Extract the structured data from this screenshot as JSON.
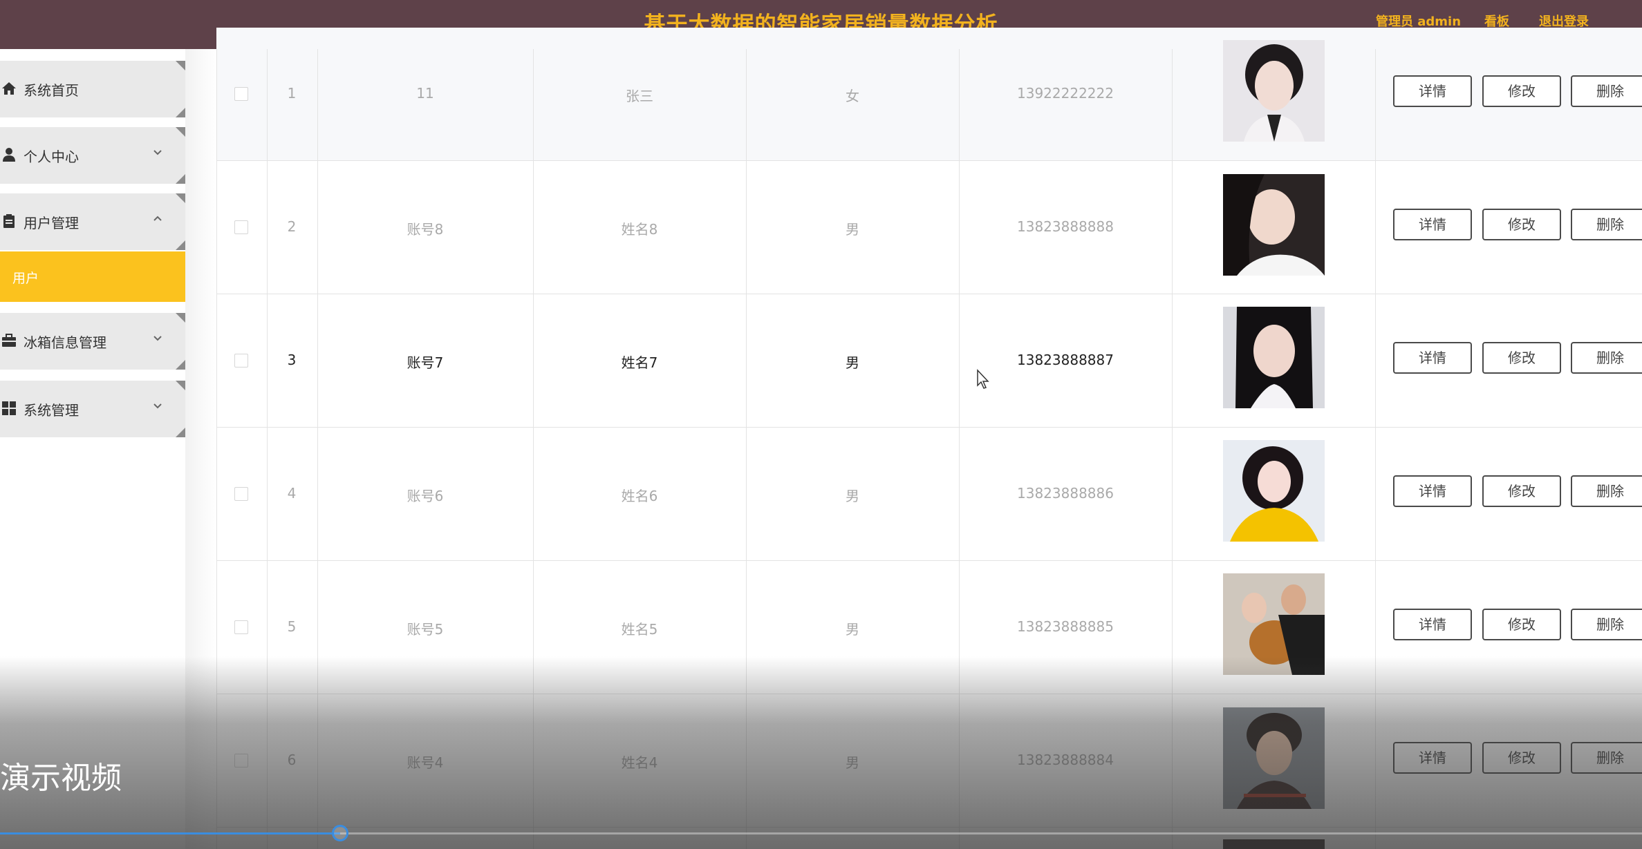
{
  "header": {
    "title": "基于大数据的智能家居销量数据分析",
    "admin_label": "管理员 admin",
    "board_label": "看板",
    "logout_label": "退出登录",
    "accent_color": "#f2b21e",
    "bg_color": "#5e4149"
  },
  "sidebar": {
    "items": [
      {
        "label": "系统首页",
        "icon": "home-icon",
        "chevron": ""
      },
      {
        "label": "个人中心",
        "icon": "person-icon",
        "chevron": "down"
      },
      {
        "label": "用户管理",
        "icon": "clipboard-icon",
        "chevron": "up"
      },
      {
        "label": "冰箱信息管理",
        "icon": "briefcase-icon",
        "chevron": "down"
      },
      {
        "label": "系统管理",
        "icon": "grid-icon",
        "chevron": "down"
      }
    ],
    "subitem": {
      "label": "用户",
      "active_color": "#fbc21e"
    }
  },
  "table": {
    "rows": [
      {
        "index": "1",
        "account": "11",
        "name": "张三",
        "gender": "女",
        "phone": "13922222222"
      },
      {
        "index": "2",
        "account": "账号8",
        "name": "姓名8",
        "gender": "男",
        "phone": "13823888888"
      },
      {
        "index": "3",
        "account": "账号7",
        "name": "姓名7",
        "gender": "男",
        "phone": "13823888887"
      },
      {
        "index": "4",
        "account": "账号6",
        "name": "姓名6",
        "gender": "男",
        "phone": "13823888886"
      },
      {
        "index": "5",
        "account": "账号5",
        "name": "姓名5",
        "gender": "男",
        "phone": "13823888885"
      },
      {
        "index": "6",
        "account": "账号4",
        "name": "姓名4",
        "gender": "男",
        "phone": "13823888884"
      }
    ],
    "actions": {
      "detail": "详情",
      "edit": "修改",
      "delete": "删除"
    }
  },
  "video": {
    "title": "演示视频",
    "progress": 0.207
  }
}
